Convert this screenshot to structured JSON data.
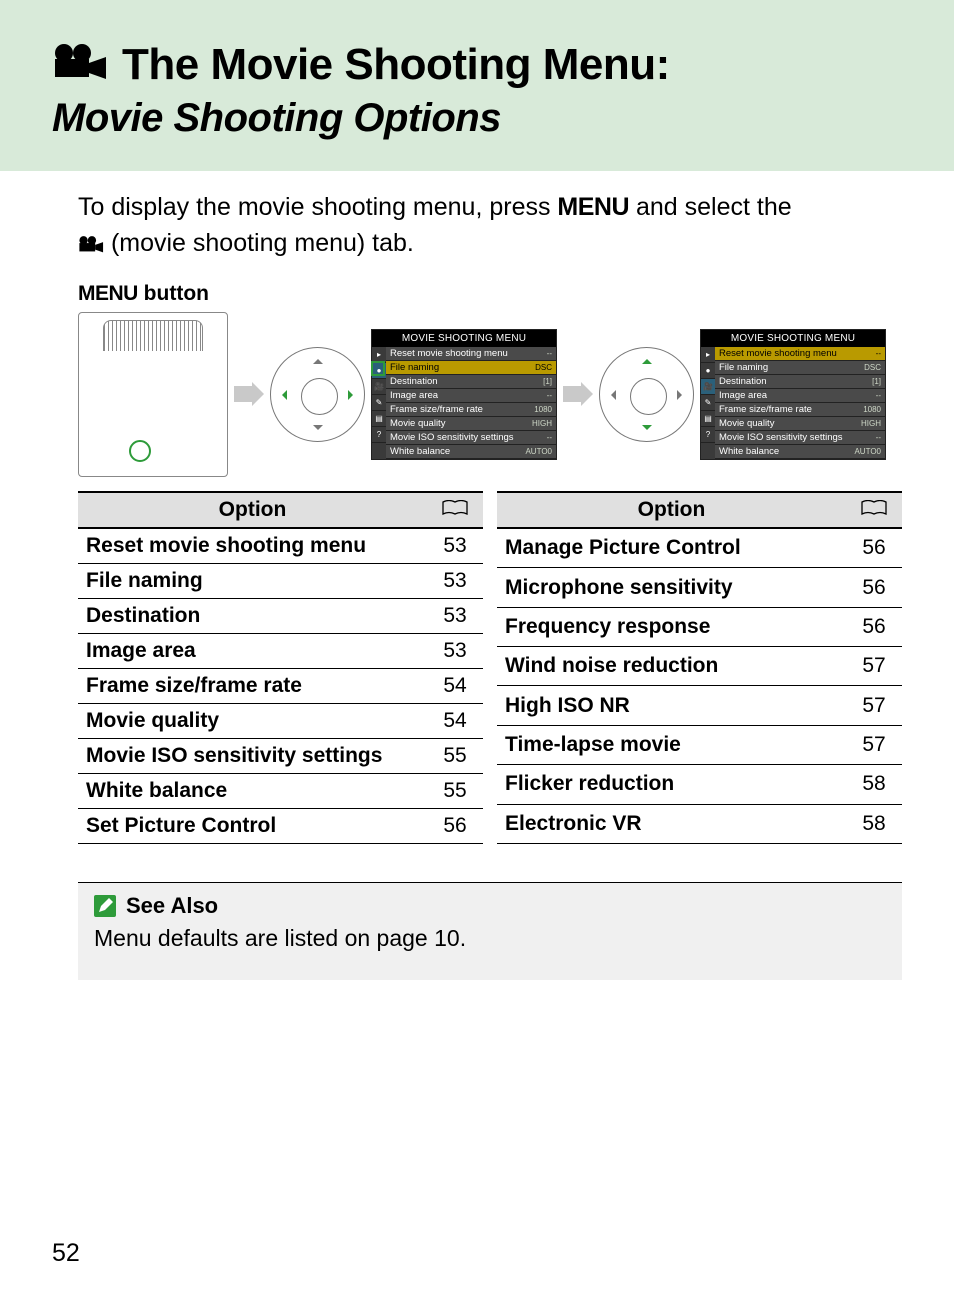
{
  "header": {
    "title": "The Movie Shooting Menu:",
    "subtitle": "Movie Shooting Options"
  },
  "intro": {
    "pre": "To display the movie shooting menu, press ",
    "menu_word": "MENU",
    "mid": " and select the ",
    "tab_label": " (movie shooting menu) tab."
  },
  "caption_menu": "MENU",
  "caption_button": " button",
  "screen": {
    "title": "MOVIE SHOOTING MENU",
    "rows": [
      {
        "label": "Reset movie shooting menu",
        "value": "--"
      },
      {
        "label": "File naming",
        "value": "DSC"
      },
      {
        "label": "Destination",
        "value": "[1]"
      },
      {
        "label": "Image area",
        "value": "--"
      },
      {
        "label": "Frame size/frame rate",
        "value": "1080"
      },
      {
        "label": "Movie quality",
        "value": "HIGH"
      },
      {
        "label": "Movie ISO sensitivity settings",
        "value": "--"
      },
      {
        "label": "White balance",
        "value": "AUTO0"
      }
    ]
  },
  "tables": {
    "header_option": "Option",
    "left": [
      {
        "name": "Reset movie shooting menu",
        "page": "53"
      },
      {
        "name": "File naming",
        "page": "53"
      },
      {
        "name": "Destination",
        "page": "53"
      },
      {
        "name": "Image area",
        "page": "53"
      },
      {
        "name": "Frame size/frame rate",
        "page": "54"
      },
      {
        "name": "Movie quality",
        "page": "54"
      },
      {
        "name": "Movie ISO sensitivity settings",
        "page": "55"
      },
      {
        "name": "White balance",
        "page": "55"
      },
      {
        "name": "Set Picture Control",
        "page": "56"
      }
    ],
    "right": [
      {
        "name": "Manage Picture Control",
        "page": "56"
      },
      {
        "name": "Microphone sensitivity",
        "page": "56"
      },
      {
        "name": "Frequency response",
        "page": "56"
      },
      {
        "name": "Wind noise reduction",
        "page": "57"
      },
      {
        "name": "High ISO NR",
        "page": "57"
      },
      {
        "name": "Time-lapse movie",
        "page": "57"
      },
      {
        "name": "Flicker reduction",
        "page": "58"
      },
      {
        "name": "Electronic VR",
        "page": "58"
      }
    ]
  },
  "see_also": {
    "title": "See Also",
    "body": "Menu defaults are listed on page 10."
  },
  "page_number": "52"
}
